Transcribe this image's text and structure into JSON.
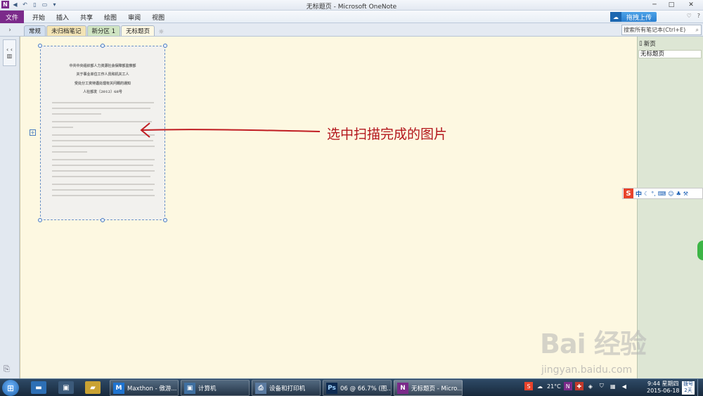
{
  "window": {
    "title": "无标题页 - Microsoft OneNote",
    "app_logo": "N",
    "buttons": {
      "minimize": "─",
      "maximize": "□",
      "close": "✕"
    }
  },
  "ribbon": {
    "file_tab": "文件",
    "tabs": [
      "开始",
      "插入",
      "共享",
      "绘图",
      "审阅",
      "视图"
    ],
    "upload_button": "拖拽上传",
    "help_icon": "?"
  },
  "sections": {
    "notebook_toggle": "›",
    "tabs": [
      {
        "label": "常规",
        "color": "#d3e0f0",
        "active": false
      },
      {
        "label": "未归档笔记",
        "color": "#f3e4b5",
        "active": false
      },
      {
        "label": "新分区 1",
        "color": "#cfe4c2",
        "active": false
      },
      {
        "label": "无标题页",
        "color": "#fdf8e4",
        "active": true
      }
    ],
    "add_tab": "☼",
    "search_placeholder": "搜索所有笔记本(Ctrl+E)"
  },
  "leftnav": {
    "label": "‹ ‹"
  },
  "document": {
    "lines": [
      "中共中央组织部人力资源社会保障部监察部",
      "关于事业单位工作人员和机关工人",
      "受处分工资待遇处理有关问题的通知",
      "人社部发〔2012〕68号"
    ]
  },
  "annotation": {
    "text": "选中扫描完成的图片",
    "color": "#b3161c"
  },
  "pagelist": {
    "new_page": "新页",
    "pages": [
      "无标题页"
    ]
  },
  "ime": {
    "logo": "S",
    "mode": "中"
  },
  "watermark": {
    "main": "Bai 经验",
    "sub": "jingyan.baidu.com"
  },
  "taskbar": {
    "items": [
      {
        "label": "Maxthon - 傲游...",
        "icon": "M",
        "icon_color": "#1e73d0",
        "active": false
      },
      {
        "label": "计算机",
        "icon": "▣",
        "icon_color": "#3f6fa0",
        "active": false
      },
      {
        "label": "设备和打印机",
        "icon": "⎙",
        "icon_color": "#5a7aa0",
        "active": false
      },
      {
        "label": "06 @ 66.7% (图...",
        "icon": "Ps",
        "icon_color": "#0e2b52",
        "active": false
      },
      {
        "label": "无标题页 - Micro...",
        "icon": "N",
        "icon_color": "#7b2a8a",
        "active": true
      }
    ],
    "temperature": "21°C",
    "time": "9:44 星期四",
    "date": "2015-06-18",
    "flag_text": "拨号 2天"
  }
}
